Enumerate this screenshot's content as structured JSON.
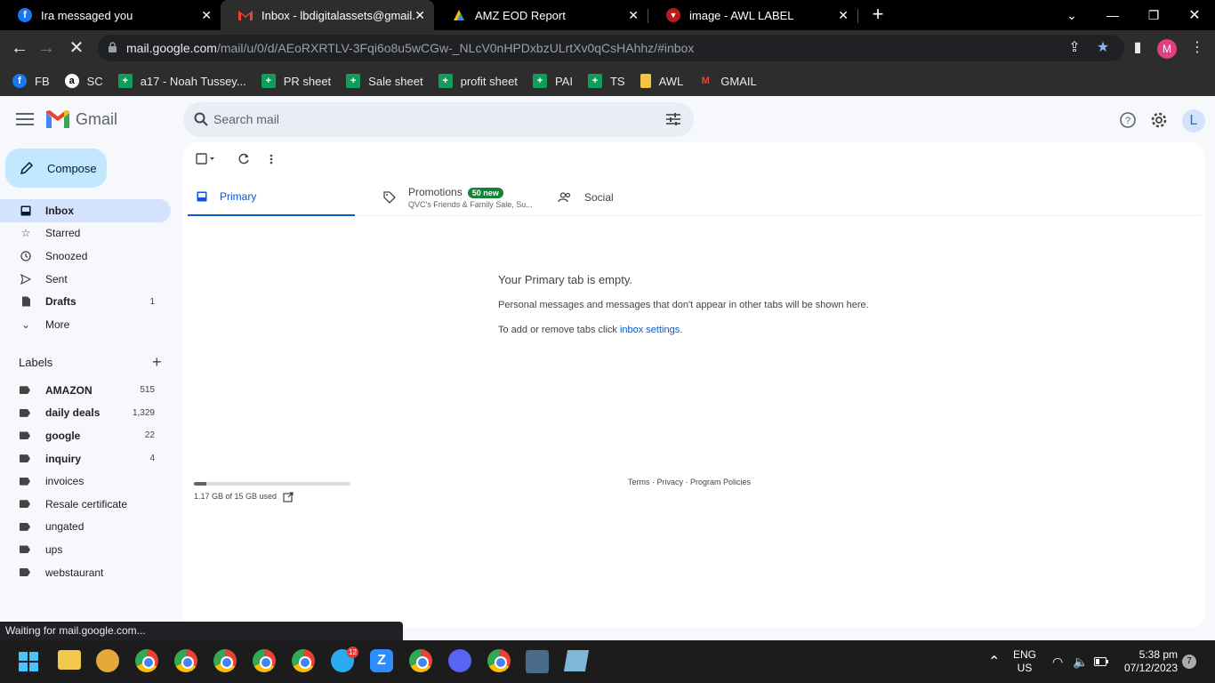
{
  "browser": {
    "tabs": [
      {
        "label": "Ira messaged you",
        "favicon": "facebook-icon",
        "color": "#1877f2"
      },
      {
        "label": "Inbox - lbdigitalassets@gmail.com",
        "favicon": "gmail-icon",
        "color": "#ea4335",
        "active": true
      },
      {
        "label": "AMZ EOD Report",
        "favicon": "google-sheets-icon",
        "color": "#0f9d58"
      },
      {
        "label": "image - AWL LABEL",
        "favicon": "awl-icon",
        "color": "#d93025"
      }
    ],
    "url_host": "mail.google.com",
    "url_path": "/mail/u/0/d/AEoRXRTLV-3Fqi6o8u5wCGw-_NLcV0nHPDxbzULrtXv0qCsHAhhz/#inbox",
    "profile_initial": "M"
  },
  "bookmarks": [
    {
      "label": "FB",
      "icon": "facebook-icon"
    },
    {
      "label": "SC",
      "icon": "amazon-icon"
    },
    {
      "label": "a17 - Noah Tussey...",
      "icon": "sheets-icon"
    },
    {
      "label": "PR sheet",
      "icon": "sheets-icon"
    },
    {
      "label": "Sale sheet",
      "icon": "sheets-icon"
    },
    {
      "label": "profit sheet",
      "icon": "sheets-icon"
    },
    {
      "label": "PAI",
      "icon": "sheets-icon"
    },
    {
      "label": "TS",
      "icon": "sheets-icon"
    },
    {
      "label": "AWL",
      "icon": "note-icon"
    },
    {
      "label": "GMAIL",
      "icon": "gmail-icon"
    }
  ],
  "gmail": {
    "title": "Gmail",
    "search_placeholder": "Search mail",
    "account_initial": "L",
    "compose_label": "Compose",
    "nav": [
      {
        "label": "Inbox",
        "count": "",
        "icon": "inbox-icon"
      },
      {
        "label": "Starred",
        "count": "",
        "icon": "star-icon"
      },
      {
        "label": "Snoozed",
        "count": "",
        "icon": "clock-icon"
      },
      {
        "label": "Sent",
        "count": "",
        "icon": "send-icon"
      },
      {
        "label": "Drafts",
        "count": "1",
        "icon": "draft-icon"
      },
      {
        "label": "More",
        "count": "",
        "icon": "chevron-down-icon"
      }
    ],
    "labels_heading": "Labels",
    "labels": [
      {
        "label": "AMAZON",
        "count": "515"
      },
      {
        "label": "daily deals",
        "count": "1,329"
      },
      {
        "label": "google",
        "count": "22"
      },
      {
        "label": "inquiry",
        "count": "4"
      },
      {
        "label": "invoices",
        "count": ""
      },
      {
        "label": "Resale certificate",
        "count": ""
      },
      {
        "label": "ungated",
        "count": ""
      },
      {
        "label": "ups",
        "count": ""
      },
      {
        "label": "webstaurant",
        "count": ""
      }
    ],
    "tabs": {
      "primary": "Primary",
      "promotions": "Promotions",
      "promotions_badge": "50 new",
      "promotions_sub": "QVC's Friends & Family Sale, Su...",
      "social": "Social"
    },
    "empty": {
      "title": "Your Primary tab is empty.",
      "message": "Personal messages and messages that don't appear in other tabs will be shown here.",
      "add_prefix": "To add or remove tabs click ",
      "add_link": "inbox settings",
      "add_suffix": "."
    },
    "storage": {
      "text": "1.17 GB of 15 GB used",
      "used_fraction": 0.078
    },
    "footer": "Terms · Privacy · Program Policies",
    "status": "Waiting for mail.google.com..."
  },
  "taskbar": {
    "telegram_badge": "12",
    "lang": "ENG",
    "region": "US",
    "time": "5:38 pm",
    "date": "07/12/2023",
    "notif_count": "7"
  }
}
